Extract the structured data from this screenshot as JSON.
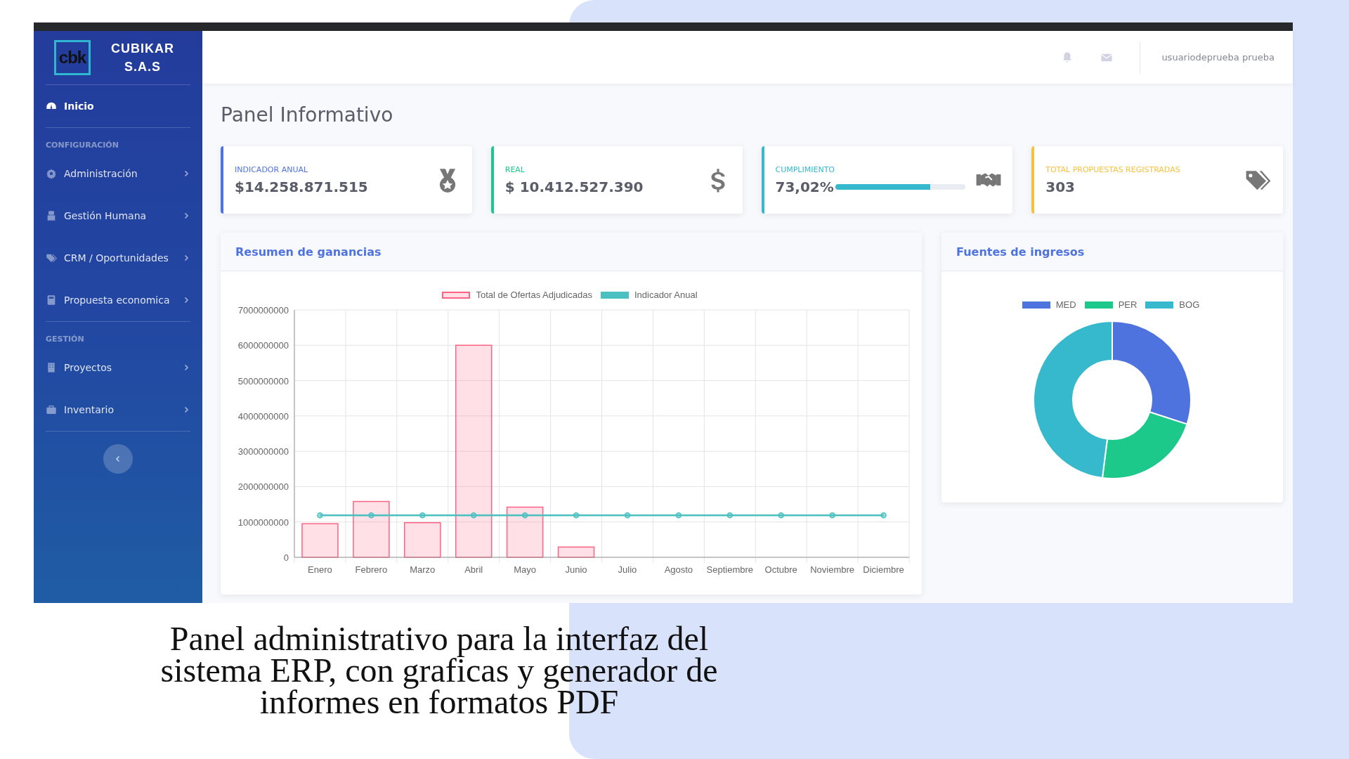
{
  "sidebar": {
    "brand": {
      "logo": "cbk",
      "name": "CUBIKAR S.A.S"
    },
    "items": [
      {
        "label": "Inicio",
        "selected": true
      }
    ],
    "sections": [
      {
        "heading": "CONFIGURACIÓN",
        "items": [
          {
            "label": "Administración",
            "selected": false
          },
          {
            "label": "Gestión Humana",
            "selected": false
          },
          {
            "label": "CRM / Oportunidades",
            "selected": false
          },
          {
            "label": "Propuesta economica",
            "selected": false
          }
        ]
      },
      {
        "heading": "GESTIÓN",
        "items": [
          {
            "label": "Proyectos",
            "selected": false
          },
          {
            "label": "Inventario",
            "selected": false
          }
        ]
      }
    ]
  },
  "topbar": {
    "user": "usuariodeprueba prueba"
  },
  "page_title": "Panel Informativo",
  "cards": [
    {
      "kind": "value",
      "label": "INDICADOR ANUAL",
      "value": "$14.258.871.515",
      "color": "#4e73df"
    },
    {
      "kind": "value",
      "label": "REAL",
      "value": "$ 10.412.527.390",
      "color": "#1cc88a"
    },
    {
      "kind": "progress",
      "label": "CUMPLIMIENTO",
      "value": "73,02%",
      "level": 0.73,
      "color": "#36b9cc"
    },
    {
      "kind": "value",
      "label": "TOTAL PROPUESTAS REGISTRADAS",
      "value": "303",
      "color": "#f6c23e"
    }
  ],
  "earnings": {
    "title": "Resumen de ganancias",
    "chart_data": {
      "type": "bar",
      "categories": [
        "Enero",
        "Febrero",
        "Marzo",
        "Abril",
        "Mayo",
        "Junio",
        "Julio",
        "Agosto",
        "Septiembre",
        "Octubre",
        "Noviembre",
        "Diciembre"
      ],
      "series": [
        {
          "name": "Total de Ofertas Adjudicadas",
          "color": "#ff6384",
          "values": [
            950000000,
            1580000000,
            980000000,
            6000000000,
            1420000000,
            290000000,
            0,
            0,
            0,
            0,
            0,
            0
          ]
        },
        {
          "name": "Indicador Anual",
          "type": "line",
          "marker": "circle",
          "color": "#4bc0c0",
          "values": [
            1190000000,
            1190000000,
            1190000000,
            1190000000,
            1190000000,
            1190000000,
            1190000000,
            1190000000,
            1190000000,
            1190000000,
            1190000000,
            1190000000
          ]
        }
      ],
      "grid": true,
      "legend": "top",
      "ylim": [
        0,
        7000000000
      ],
      "yticks": [
        0,
        1000000000,
        2000000000,
        3000000000,
        4000000000,
        5000000000,
        6000000000,
        7000000000
      ]
    }
  },
  "sources": {
    "title": "Fuentes de ingresos",
    "legend": [
      {
        "label": "MED",
        "color": "#4e73df"
      },
      {
        "label": "PER",
        "color": "#1cc88a"
      },
      {
        "label": "BOG",
        "color": "#36b9cc"
      }
    ]
  },
  "caption": [
    "Panel administrativo para la interfaz del",
    "sistema ERP, con graficas y generador de",
    "informes en formatos PDF"
  ]
}
